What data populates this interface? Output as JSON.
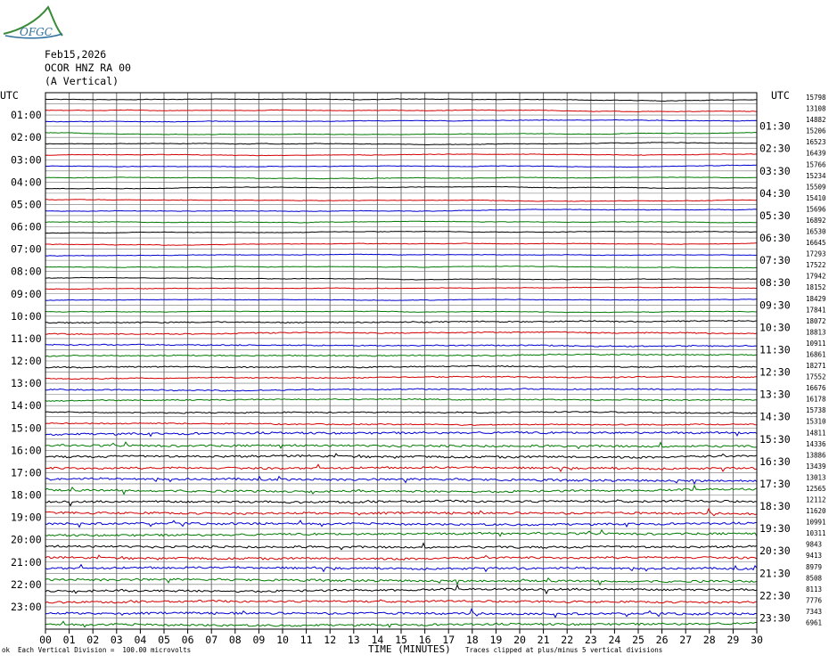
{
  "logo": {
    "text": "OFGC",
    "color": "#2f6f9e",
    "swoosh_color": "#3a8a3a"
  },
  "header": {
    "date": "Feb15,2026",
    "station": "OCOR HNZ RA 00",
    "component": "(A Vertical)"
  },
  "axis": {
    "left_title": "UTC",
    "right_title": "UTC",
    "x_title": "TIME (MINUTES)"
  },
  "footer": {
    "scale_note": "Each Vertical Division =  100.00 microvolts",
    "clip_note": "Traces clipped at plus/minus 5 vertical divisions",
    "corner_mark": "ok"
  },
  "chart_data": {
    "type": "line",
    "title": "",
    "xlabel": "TIME (MINUTES)",
    "xlim": [
      0,
      30
    ],
    "x_ticks": [
      "00",
      "01",
      "02",
      "03",
      "04",
      "05",
      "06",
      "07",
      "08",
      "09",
      "10",
      "11",
      "12",
      "13",
      "14",
      "15",
      "16",
      "17",
      "18",
      "19",
      "20",
      "21",
      "22",
      "23",
      "24",
      "25",
      "26",
      "27",
      "28",
      "29",
      "30"
    ],
    "left_labels": [
      "01:00",
      "02:00",
      "03:00",
      "04:00",
      "05:00",
      "06:00",
      "07:00",
      "08:00",
      "09:00",
      "10:00",
      "11:00",
      "12:00",
      "13:00",
      "14:00",
      "15:00",
      "16:00",
      "17:00",
      "18:00",
      "19:00",
      "20:00",
      "21:00",
      "22:00",
      "23:00"
    ],
    "right_labels": [
      "01:30",
      "02:30",
      "03:30",
      "04:30",
      "05:30",
      "06:30",
      "07:30",
      "08:30",
      "09:30",
      "10:30",
      "11:30",
      "12:30",
      "13:30",
      "14:30",
      "15:30",
      "16:30",
      "17:30",
      "18:30",
      "19:30",
      "20:30",
      "21:30",
      "22:30",
      "23:30"
    ],
    "trace_colors": [
      "#000000",
      "#d40000",
      "#0000d0",
      "#007a00"
    ],
    "grid": true,
    "traces": [
      {
        "start": "00:00",
        "count": 15798
      },
      {
        "start": "00:30",
        "count": 13108
      },
      {
        "start": "01:00",
        "count": 14882
      },
      {
        "start": "01:30",
        "count": 15206
      },
      {
        "start": "02:00",
        "count": 16523
      },
      {
        "start": "02:30",
        "count": 16439
      },
      {
        "start": "03:00",
        "count": 15766
      },
      {
        "start": "03:30",
        "count": 15234
      },
      {
        "start": "04:00",
        "count": 15509
      },
      {
        "start": "04:30",
        "count": 15410
      },
      {
        "start": "05:00",
        "count": 15696
      },
      {
        "start": "05:30",
        "count": 16892
      },
      {
        "start": "06:00",
        "count": 16530
      },
      {
        "start": "06:30",
        "count": 16645
      },
      {
        "start": "07:00",
        "count": 17293
      },
      {
        "start": "07:30",
        "count": 17522
      },
      {
        "start": "08:00",
        "count": 17942
      },
      {
        "start": "08:30",
        "count": 18152
      },
      {
        "start": "09:00",
        "count": 18429
      },
      {
        "start": "09:30",
        "count": 17841
      },
      {
        "start": "10:00",
        "count": 18072
      },
      {
        "start": "10:30",
        "count": 18813
      },
      {
        "start": "11:00",
        "count": 10911
      },
      {
        "start": "11:30",
        "count": 16861
      },
      {
        "start": "12:00",
        "count": 18271
      },
      {
        "start": "12:30",
        "count": 17552
      },
      {
        "start": "13:00",
        "count": 16676
      },
      {
        "start": "13:30",
        "count": 16178
      },
      {
        "start": "14:00",
        "count": 15738
      },
      {
        "start": "14:30",
        "count": 15310
      },
      {
        "start": "15:00",
        "count": 14811
      },
      {
        "start": "15:30",
        "count": 14336
      },
      {
        "start": "16:00",
        "count": 13886
      },
      {
        "start": "16:30",
        "count": 13439
      },
      {
        "start": "17:00",
        "count": 13013
      },
      {
        "start": "17:30",
        "count": 12565
      },
      {
        "start": "18:00",
        "count": 12112
      },
      {
        "start": "18:30",
        "count": 11620
      },
      {
        "start": "19:00",
        "count": 10991
      },
      {
        "start": "19:30",
        "count": 10311
      },
      {
        "start": "20:00",
        "count": 9843
      },
      {
        "start": "20:30",
        "count": 9413
      },
      {
        "start": "21:00",
        "count": 8979
      },
      {
        "start": "21:30",
        "count": 8508
      },
      {
        "start": "22:00",
        "count": 8113
      },
      {
        "start": "22:30",
        "count": 7776
      },
      {
        "start": "23:00",
        "count": 7343
      },
      {
        "start": "23:30",
        "count": 6961
      }
    ]
  }
}
